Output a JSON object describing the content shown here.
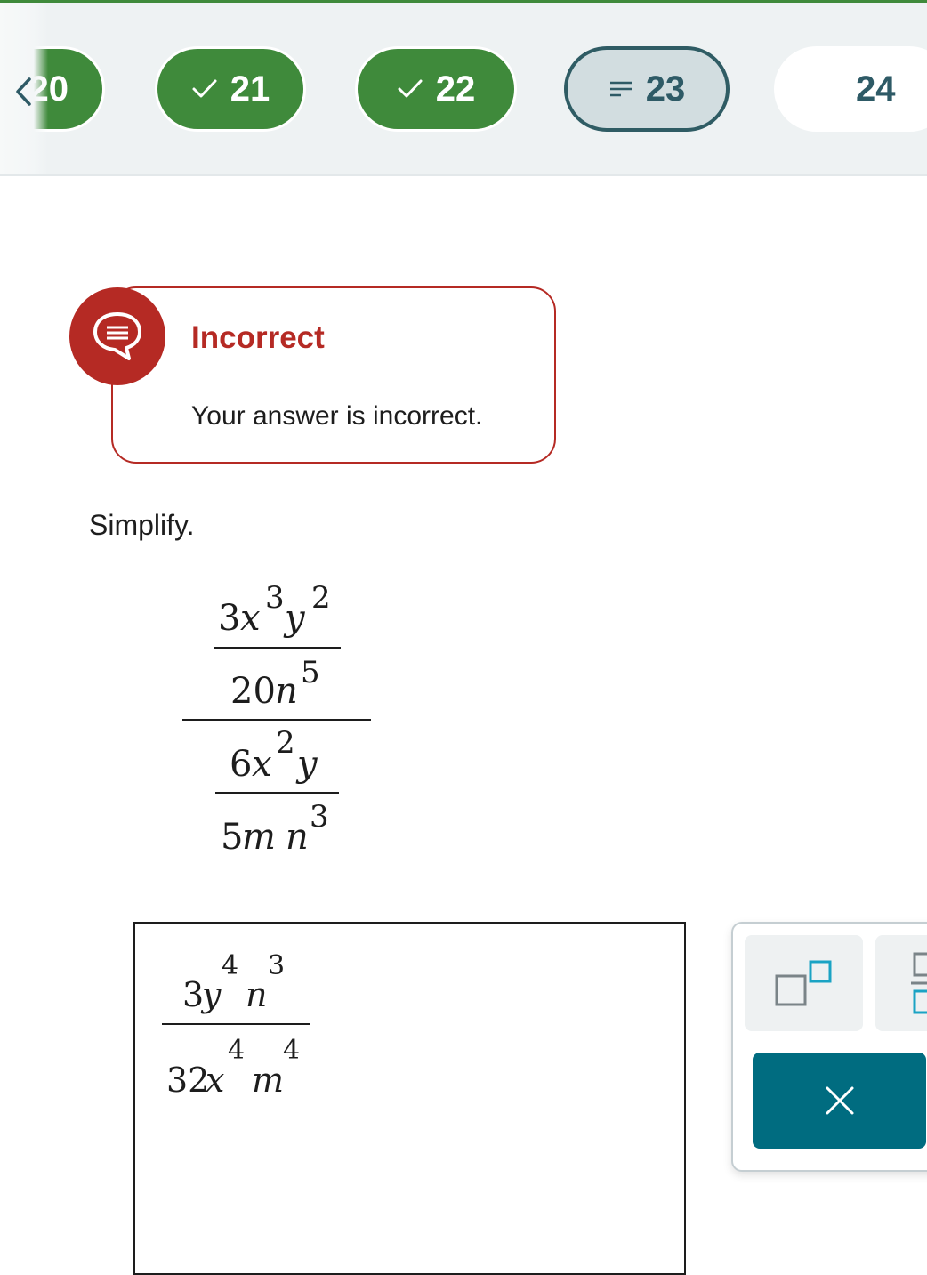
{
  "question_nav": {
    "items": [
      {
        "number": "20",
        "status": "done"
      },
      {
        "number": "21",
        "status": "done"
      },
      {
        "number": "22",
        "status": "done"
      },
      {
        "number": "23",
        "status": "current"
      },
      {
        "number": "24",
        "status": "todo"
      }
    ],
    "colors": {
      "done": "#3f8a3b",
      "current_fill": "#d2dde0",
      "current_border": "#2f5c64",
      "text_dark": "#2e5a66"
    }
  },
  "feedback": {
    "title": "Incorrect",
    "message": "Your answer is incorrect.",
    "color": "#b52a24",
    "icon": "speech-bubble-icon"
  },
  "problem": {
    "prompt": "Simplify.",
    "expression": {
      "top_numerator": {
        "coef": "3",
        "terms": [
          {
            "var": "x",
            "exp": "3"
          },
          {
            "var": "y",
            "exp": "2"
          }
        ]
      },
      "top_denominator": {
        "coef": "20",
        "terms": [
          {
            "var": "n",
            "exp": "5"
          }
        ]
      },
      "bottom_numerator": {
        "coef": "6",
        "terms": [
          {
            "var": "x",
            "exp": "2"
          },
          {
            "var": "y",
            "exp": ""
          }
        ]
      },
      "bottom_denominator": {
        "coef": "5",
        "terms": [
          {
            "var": "m",
            "exp": ""
          },
          {
            "var": "n",
            "exp": "3"
          }
        ]
      }
    }
  },
  "answer": {
    "numerator": {
      "coef": "3",
      "terms": [
        {
          "var": "y",
          "exp": "4"
        },
        {
          "var": "n",
          "exp": "3"
        }
      ]
    },
    "denominator": {
      "coef": "32",
      "terms": [
        {
          "var": "x",
          "exp": "4"
        },
        {
          "var": "m",
          "exp": "4"
        }
      ]
    }
  },
  "tools": {
    "exponent_icon": "exponent-template-icon",
    "fraction_icon": "fraction-template-icon",
    "clear_icon": "close-icon",
    "clear_color": "#006c80"
  }
}
